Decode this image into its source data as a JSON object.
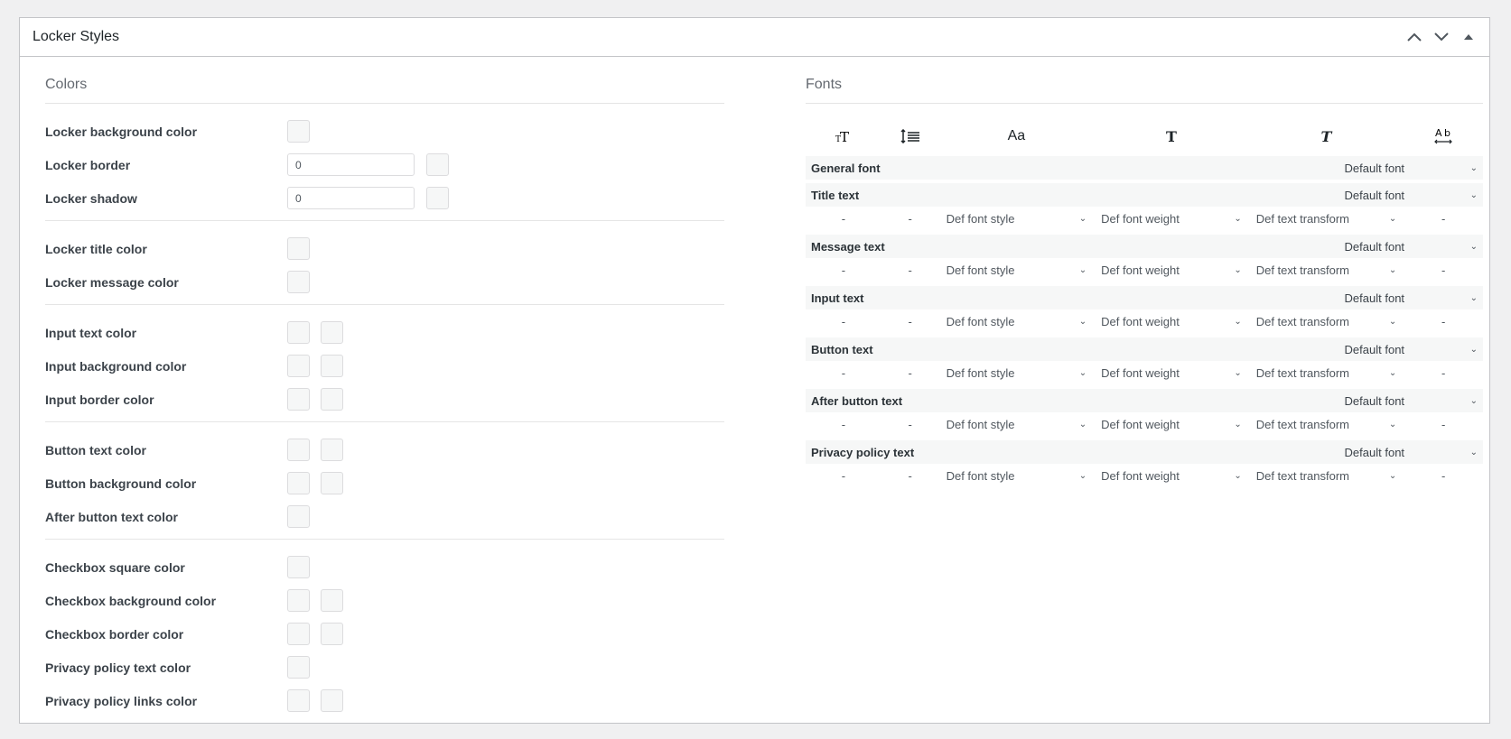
{
  "panel": {
    "title": "Locker Styles"
  },
  "colors": {
    "title": "Colors",
    "groups": [
      {
        "rows": [
          {
            "label": "Locker background color"
          },
          {
            "label": "Locker border",
            "value": "0"
          },
          {
            "label": "Locker shadow",
            "value": "0"
          }
        ]
      },
      {
        "rows": [
          {
            "label": "Locker title color"
          },
          {
            "label": "Locker message color"
          }
        ]
      },
      {
        "rows": [
          {
            "label": "Input text color"
          },
          {
            "label": "Input background color"
          },
          {
            "label": "Input border color"
          }
        ]
      },
      {
        "rows": [
          {
            "label": "Button text color"
          },
          {
            "label": "Button background color"
          },
          {
            "label": "After button text color"
          }
        ]
      },
      {
        "rows": [
          {
            "label": "Checkbox square color"
          },
          {
            "label": "Checkbox background color"
          },
          {
            "label": "Checkbox border color"
          },
          {
            "label": "Privacy policy text color"
          },
          {
            "label": "Privacy policy links color"
          }
        ]
      }
    ]
  },
  "fonts": {
    "title": "Fonts",
    "icons": [
      "font-size-icon",
      "line-height-icon",
      "font-family-icon",
      "font-weight-icon",
      "font-style-icon",
      "letter-spacing-icon"
    ],
    "icon_glyphs": {
      "font_family": "Aa",
      "font_weight": "T",
      "font_style": "T"
    },
    "default_font": "Default font",
    "dash": "-",
    "style_placeholder": "Def font style",
    "weight_placeholder": "Def font weight",
    "transform_placeholder": "Def text transform",
    "rows": [
      {
        "name": "General font"
      },
      {
        "name": "Title text"
      },
      {
        "name": "Message text"
      },
      {
        "name": "Input text"
      },
      {
        "name": "Button text"
      },
      {
        "name": "After button text"
      },
      {
        "name": "Privacy policy text"
      }
    ]
  }
}
